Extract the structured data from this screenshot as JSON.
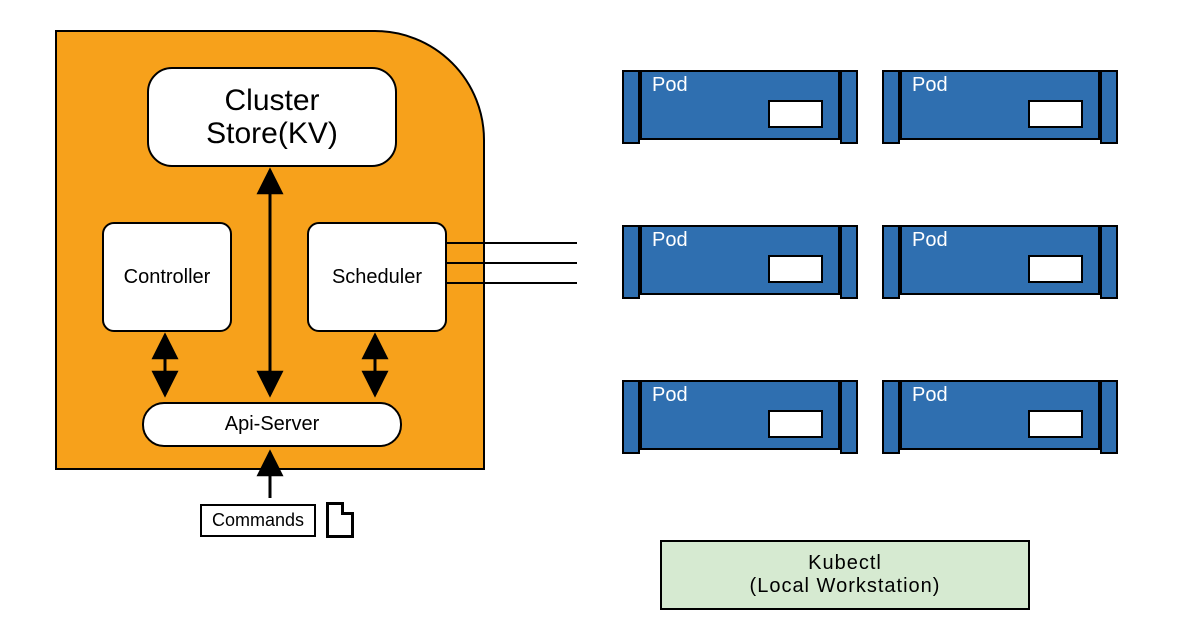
{
  "master": {
    "cluster_store": "Cluster\nStore(KV)",
    "controller": "Controller",
    "scheduler": "Scheduler",
    "api_server": "Api-Server"
  },
  "commands_label": "Commands",
  "pods": [
    {
      "label": "Pod"
    },
    {
      "label": "Pod"
    },
    {
      "label": "Pod"
    },
    {
      "label": "Pod"
    },
    {
      "label": "Pod"
    },
    {
      "label": "Pod"
    }
  ],
  "kubectl": {
    "line1": "Kubectl",
    "line2": "(Local Workstation)"
  },
  "colors": {
    "master_bg": "#f7a11b",
    "pod_bg": "#2f6fb0",
    "kubectl_bg": "#d6ead1"
  }
}
